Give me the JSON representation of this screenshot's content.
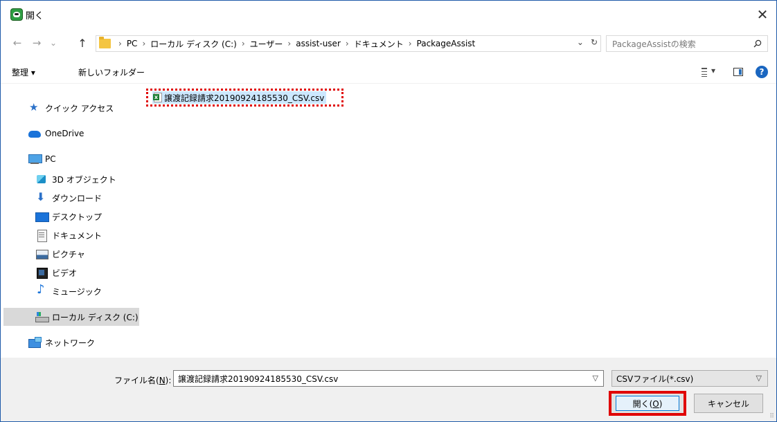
{
  "window": {
    "title": "開く",
    "close_label": "✕"
  },
  "nav": {
    "back": "←",
    "forward": "→",
    "recent": "⌄",
    "up": "↑",
    "breadcrumbs": [
      "PC",
      "ローカル ディスク (C:)",
      "ユーザー",
      "assist-user",
      "ドキュメント",
      "PackageAssist"
    ],
    "address_dropdown": "⌄",
    "refresh": "↻"
  },
  "search": {
    "placeholder": "PackageAssistの検索"
  },
  "toolbar": {
    "organize": "整理 ▾",
    "new_folder": "新しいフォルダー",
    "help": "?"
  },
  "sidebar": {
    "items": [
      {
        "label": "クイック アクセス",
        "icon": "star-icon"
      },
      {
        "label": "OneDrive",
        "icon": "cloud-icon"
      },
      {
        "label": "PC",
        "icon": "pc-icon"
      },
      {
        "label": "3D オブジェクト",
        "icon": "cube-icon"
      },
      {
        "label": "ダウンロード",
        "icon": "download-icon"
      },
      {
        "label": "デスクトップ",
        "icon": "desktop-icon"
      },
      {
        "label": "ドキュメント",
        "icon": "document-icon"
      },
      {
        "label": "ピクチャ",
        "icon": "picture-icon"
      },
      {
        "label": "ビデオ",
        "icon": "video-icon"
      },
      {
        "label": "ミュージック",
        "icon": "music-icon"
      },
      {
        "label": "ローカル ディスク (C:)",
        "icon": "drive-icon",
        "selected": true
      },
      {
        "label": "ネットワーク",
        "icon": "network-icon"
      }
    ]
  },
  "files": [
    {
      "name": "譲渡記録請求20190924185530_CSV.csv",
      "icon": "excel-csv-icon",
      "selected": true
    }
  ],
  "footer": {
    "filename_label": "ファイル名(N):",
    "filename_value": "譲渡記録請求20190924185530_CSV.csv",
    "filetype_value": "CSVファイル(*.csv)",
    "open_label": "開く(O)",
    "cancel_label": "キャンセル"
  },
  "colors": {
    "highlight_red": "#e00000",
    "accent_blue": "#0078d7",
    "selection": "#cce8ff"
  }
}
